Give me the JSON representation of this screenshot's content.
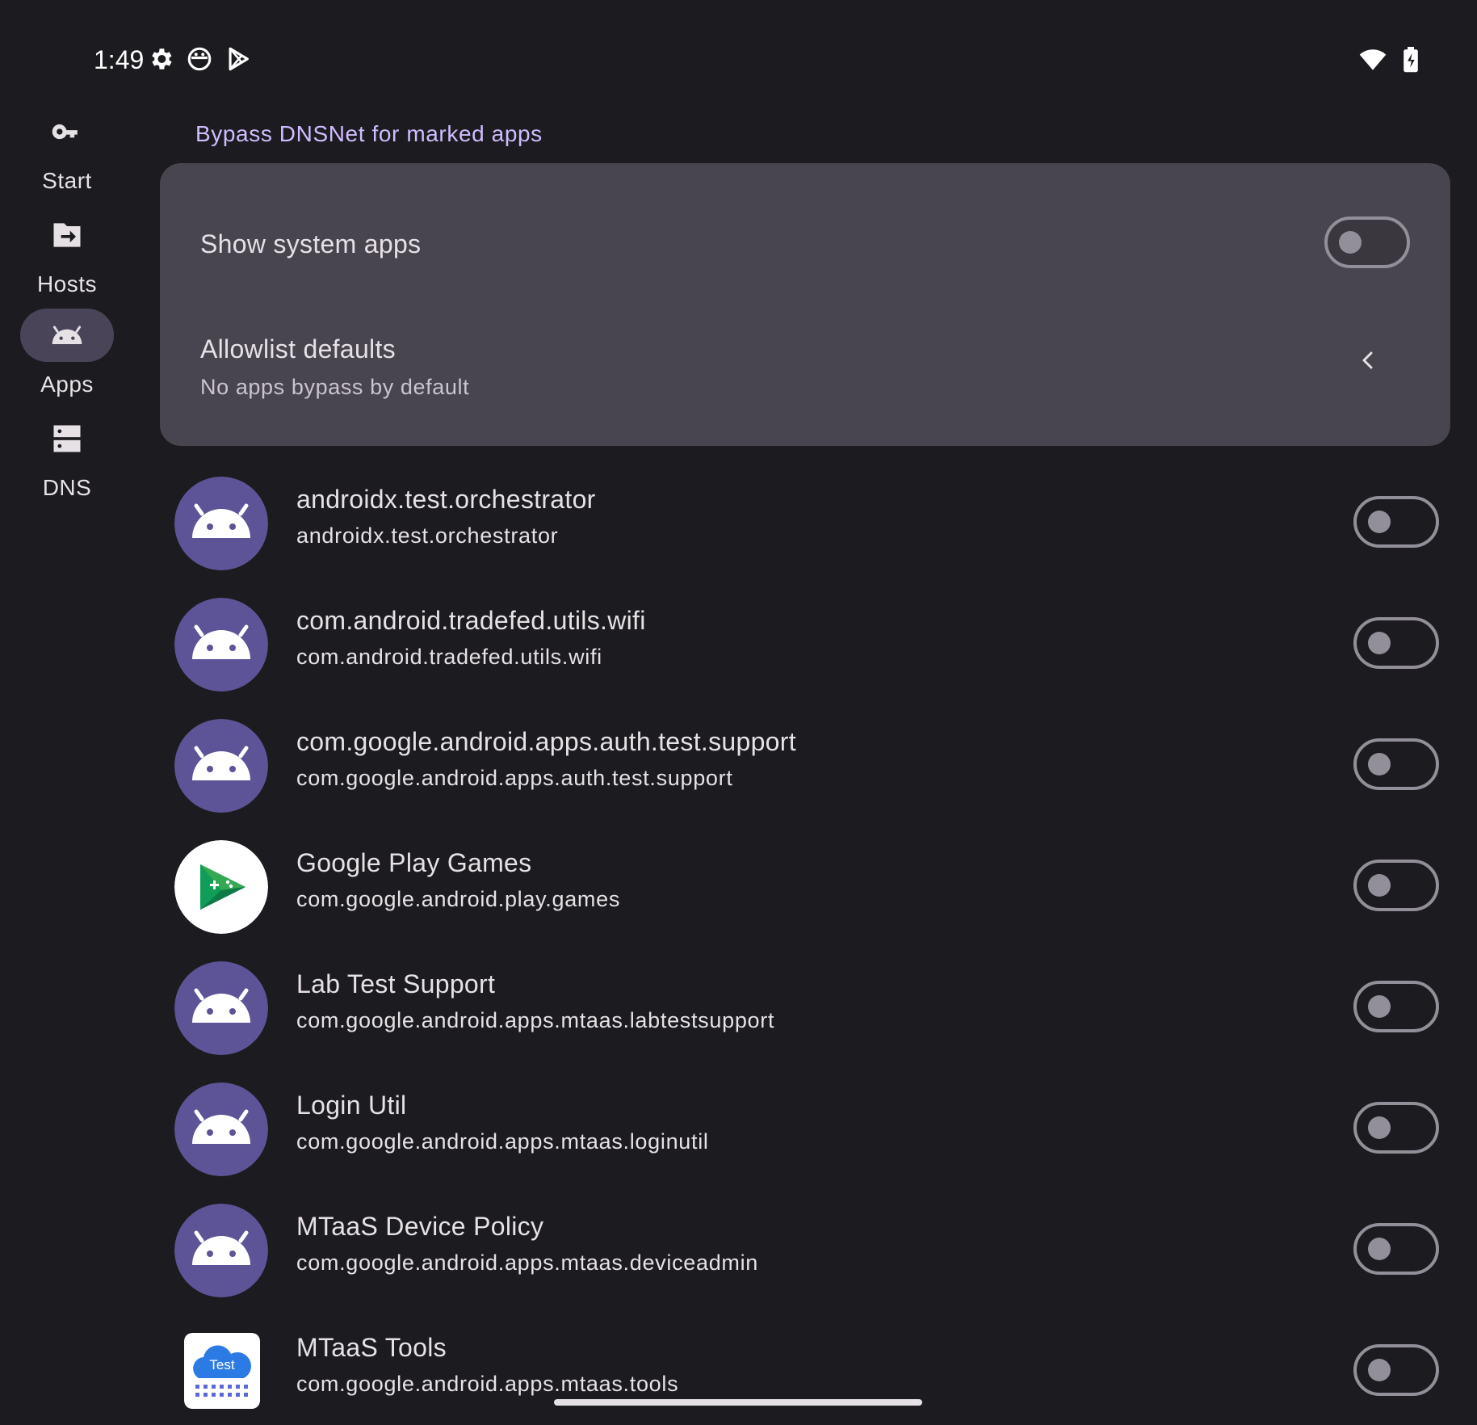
{
  "status_bar": {
    "time": "1:49",
    "left_icons": [
      "gear-icon",
      "notification-circle-icon",
      "play-store-icon"
    ],
    "right_icons": [
      "wifi-icon",
      "battery-charging-icon"
    ]
  },
  "nav_rail": {
    "items": [
      {
        "label": "Start",
        "icon": "key-icon",
        "active": false
      },
      {
        "label": "Hosts",
        "icon": "folder-import-icon",
        "active": false
      },
      {
        "label": "Apps",
        "icon": "android-icon",
        "active": true
      },
      {
        "label": "DNS",
        "icon": "dns-server-icon",
        "active": false
      }
    ]
  },
  "main": {
    "section_title": "Bypass DNSNet for marked apps",
    "settings": {
      "show_system_apps": {
        "title": "Show system apps",
        "enabled": false
      },
      "allowlist_defaults": {
        "title": "Allowlist defaults",
        "subtitle": "No apps bypass by default",
        "icon": "chevron-left-icon"
      }
    },
    "apps": [
      {
        "name": "androidx.test.orchestrator",
        "package": "androidx.test.orchestrator",
        "icon": "android-app-icon",
        "bypass": false
      },
      {
        "name": "com.android.tradefed.utils.wifi",
        "package": "com.android.tradefed.utils.wifi",
        "icon": "android-app-icon",
        "bypass": false
      },
      {
        "name": "com.google.android.apps.auth.test.support",
        "package": "com.google.android.apps.auth.test.support",
        "icon": "android-app-icon",
        "bypass": false
      },
      {
        "name": "Google Play Games",
        "package": "com.google.android.play.games",
        "icon": "play-games-icon",
        "bypass": false
      },
      {
        "name": "Lab Test Support",
        "package": "com.google.android.apps.mtaas.labtestsupport",
        "icon": "android-app-icon",
        "bypass": false
      },
      {
        "name": "Login Util",
        "package": "com.google.android.apps.mtaas.loginutil",
        "icon": "android-app-icon",
        "bypass": false
      },
      {
        "name": "MTaaS Device Policy",
        "package": "com.google.android.apps.mtaas.deviceadmin",
        "icon": "android-app-icon",
        "bypass": false
      },
      {
        "name": "MTaaS Tools",
        "package": "com.google.android.apps.mtaas.tools",
        "icon": "test-cloud-icon",
        "icon_text": "Test",
        "bypass": false
      }
    ]
  },
  "colors": {
    "background": "#1c1b1f",
    "card": "#49454f",
    "accent": "#cfbcff",
    "nav_active": "#4a4458",
    "android_icon_bg": "#5c5496"
  }
}
